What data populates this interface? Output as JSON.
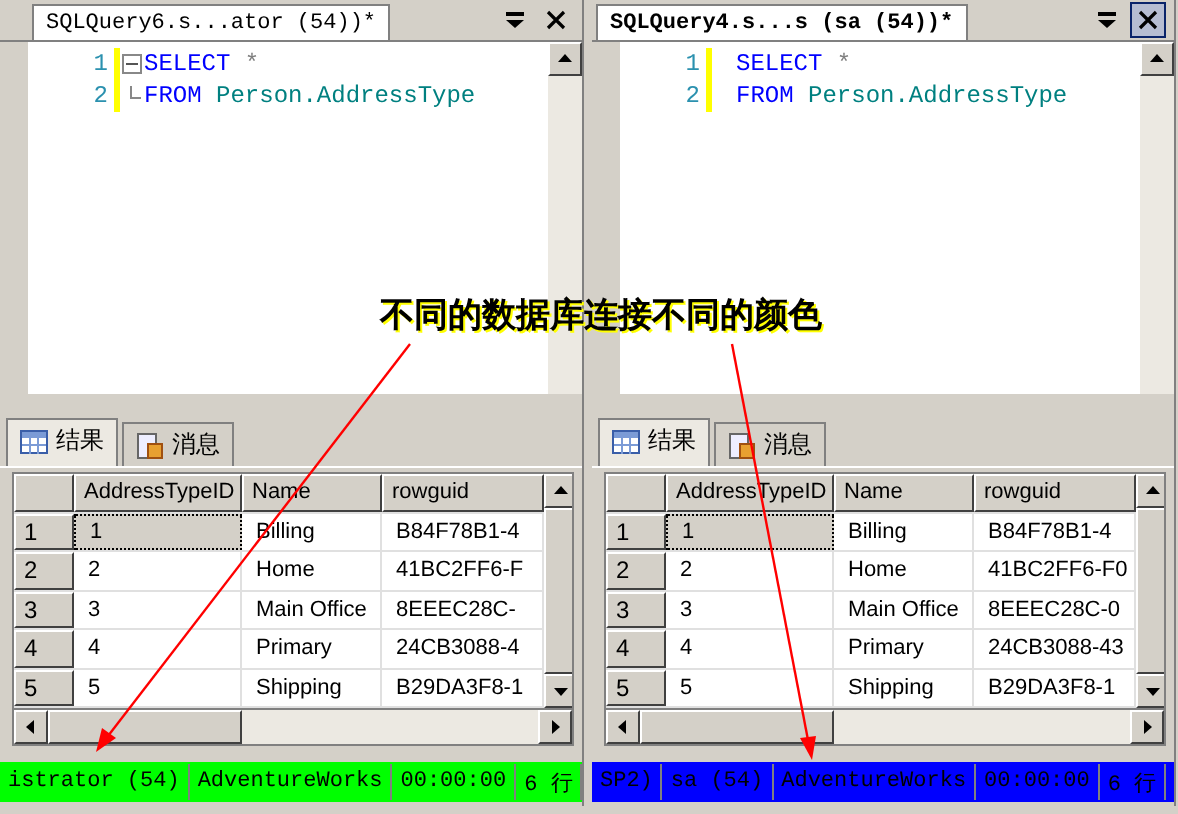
{
  "panes": [
    {
      "tab_title": "SQLQuery6.s...ator (54))*",
      "active": false,
      "outlining": true,
      "code": [
        {
          "number": "1",
          "keyword": "SELECT",
          "rest": "*",
          "kind": "star"
        },
        {
          "number": "2",
          "keyword": "FROM",
          "rest": "Person.AddressType",
          "kind": "name"
        }
      ],
      "result_tabs": [
        {
          "label": "结果",
          "selected": true
        },
        {
          "label": "消息",
          "selected": false
        }
      ],
      "columns": [
        "AddressTypeID",
        "Name",
        "rowguid"
      ],
      "rows": [
        {
          "num": "1",
          "cells": [
            "1",
            "Billing",
            "B84F78B1-4"
          ],
          "selected": true
        },
        {
          "num": "2",
          "cells": [
            "2",
            "Home",
            "41BC2FF6-F"
          ],
          "selected": false
        },
        {
          "num": "3",
          "cells": [
            "3",
            "Main Office",
            "8EEEC28C-"
          ],
          "selected": false
        },
        {
          "num": "4",
          "cells": [
            "4",
            "Primary",
            "24CB3088-4"
          ],
          "selected": false
        },
        {
          "num": "5",
          "cells": [
            "5",
            "Shipping",
            "B29DA3F8-1"
          ],
          "selected": false
        }
      ],
      "status_bar": {
        "color": "#00ff00",
        "items": [
          "istrator (54)",
          "AdventureWorks",
          "00:00:00",
          "6 行"
        ]
      }
    },
    {
      "tab_title": "SQLQuery4.s...s (sa (54))*",
      "active": true,
      "outlining": false,
      "code": [
        {
          "number": "1",
          "keyword": "SELECT",
          "rest": "*",
          "kind": "star"
        },
        {
          "number": "2",
          "keyword": "FROM",
          "rest": "Person.AddressType",
          "kind": "name"
        }
      ],
      "result_tabs": [
        {
          "label": "结果",
          "selected": true
        },
        {
          "label": "消息",
          "selected": false
        }
      ],
      "columns": [
        "AddressTypeID",
        "Name",
        "rowguid"
      ],
      "rows": [
        {
          "num": "1",
          "cells": [
            "1",
            "Billing",
            "B84F78B1-4"
          ],
          "selected": true
        },
        {
          "num": "2",
          "cells": [
            "2",
            "Home",
            "41BC2FF6-F0"
          ],
          "selected": false
        },
        {
          "num": "3",
          "cells": [
            "3",
            "Main Office",
            "8EEEC28C-0"
          ],
          "selected": false
        },
        {
          "num": "4",
          "cells": [
            "4",
            "Primary",
            "24CB3088-43"
          ],
          "selected": false
        },
        {
          "num": "5",
          "cells": [
            "5",
            "Shipping",
            "B29DA3F8-1"
          ],
          "selected": false
        }
      ],
      "status_bar": {
        "color": "#0000ff",
        "items": [
          "SP2)",
          "sa (54)",
          "AdventureWorks",
          "00:00:00",
          "6 行"
        ]
      }
    }
  ],
  "annotation": "不同的数据库连接不同的颜色"
}
